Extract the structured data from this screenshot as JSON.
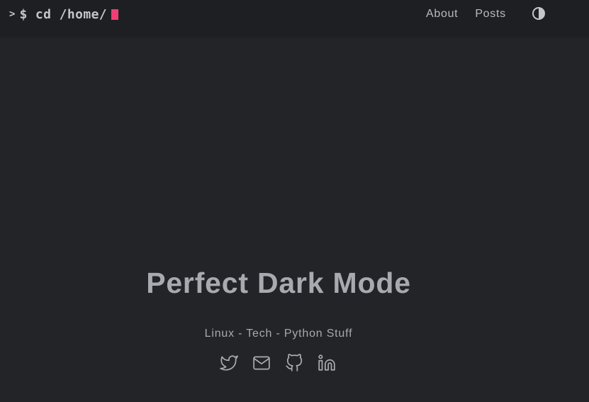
{
  "header": {
    "logo": {
      "prompt_symbol": ">",
      "command": "$ cd /home/"
    },
    "nav": {
      "items": [
        {
          "label": "About"
        },
        {
          "label": "Posts"
        }
      ]
    },
    "theme_toggle_icon": "half-circle-contrast-icon"
  },
  "hero": {
    "title": "Perfect Dark Mode",
    "subtitle": "Linux - Tech - Python Stuff",
    "social_icons": [
      "twitter-icon",
      "mail-icon",
      "github-icon",
      "linkedin-icon"
    ]
  },
  "colors": {
    "page_background": "#232427",
    "header_background": "#1e1f22",
    "cursor_accent": "#ee3f74",
    "text": "#a9aab0"
  }
}
